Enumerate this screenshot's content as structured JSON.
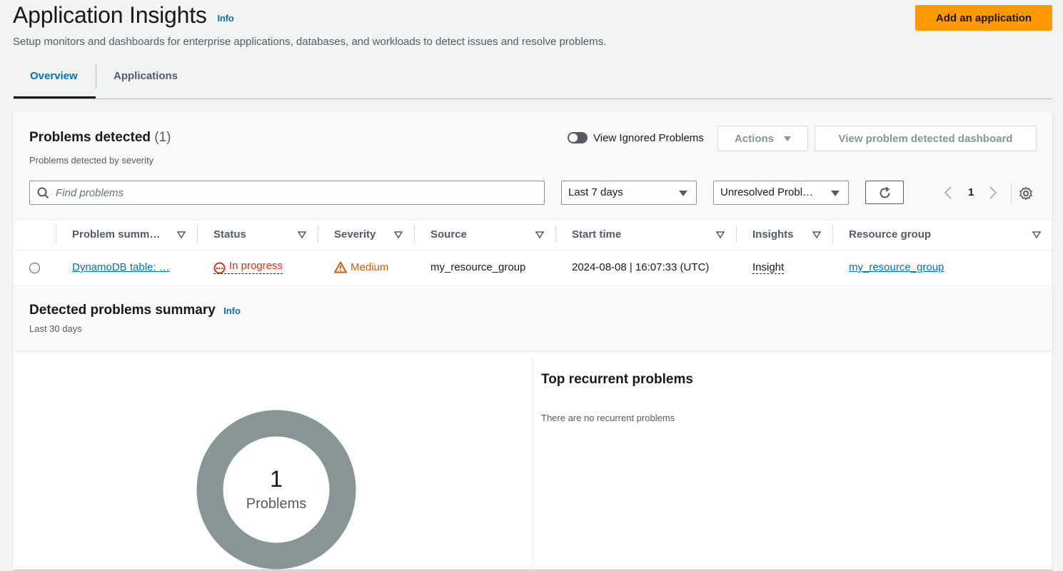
{
  "header": {
    "title": "Application Insights",
    "info": "Info",
    "subtitle": "Setup monitors and dashboards for enterprise applications, databases, and workloads to detect issues and resolve problems.",
    "add_button": "Add an application"
  },
  "tabs": [
    {
      "label": "Overview",
      "active": true
    },
    {
      "label": "Applications",
      "active": false
    }
  ],
  "problems": {
    "title": "Problems detected",
    "count": "(1)",
    "description": "Problems detected by severity",
    "toggle_label": "View Ignored Problems",
    "actions_label": "Actions",
    "dashboard_button": "View problem detected dashboard",
    "search_placeholder": "Find problems",
    "time_filter": "Last 7 days",
    "status_filter": "Unresolved Probl…",
    "page_number": "1",
    "columns": [
      "Problem summ…",
      "Status",
      "Severity",
      "Source",
      "Start time",
      "Insights",
      "Resource group"
    ],
    "rows": [
      {
        "summary": "DynamoDB table: …",
        "status": "In progress",
        "severity": "Medium",
        "source": "my_resource_group",
        "start_time": "2024-08-08 | 16:07:33 (UTC)",
        "insights": "Insight",
        "resource_group": "my_resource_group"
      }
    ]
  },
  "summary": {
    "title": "Detected problems summary",
    "info": "Info",
    "period": "Last 30 days",
    "donut_value": "1",
    "donut_label": "Problems",
    "recurrent_title": "Top recurrent problems",
    "recurrent_empty": "There are no recurrent problems"
  },
  "colors": {
    "accent": "#ff9900",
    "link": "#0073bb",
    "status_in_progress": "#d13212",
    "severity_medium": "#d45b07",
    "donut": "#879596"
  }
}
